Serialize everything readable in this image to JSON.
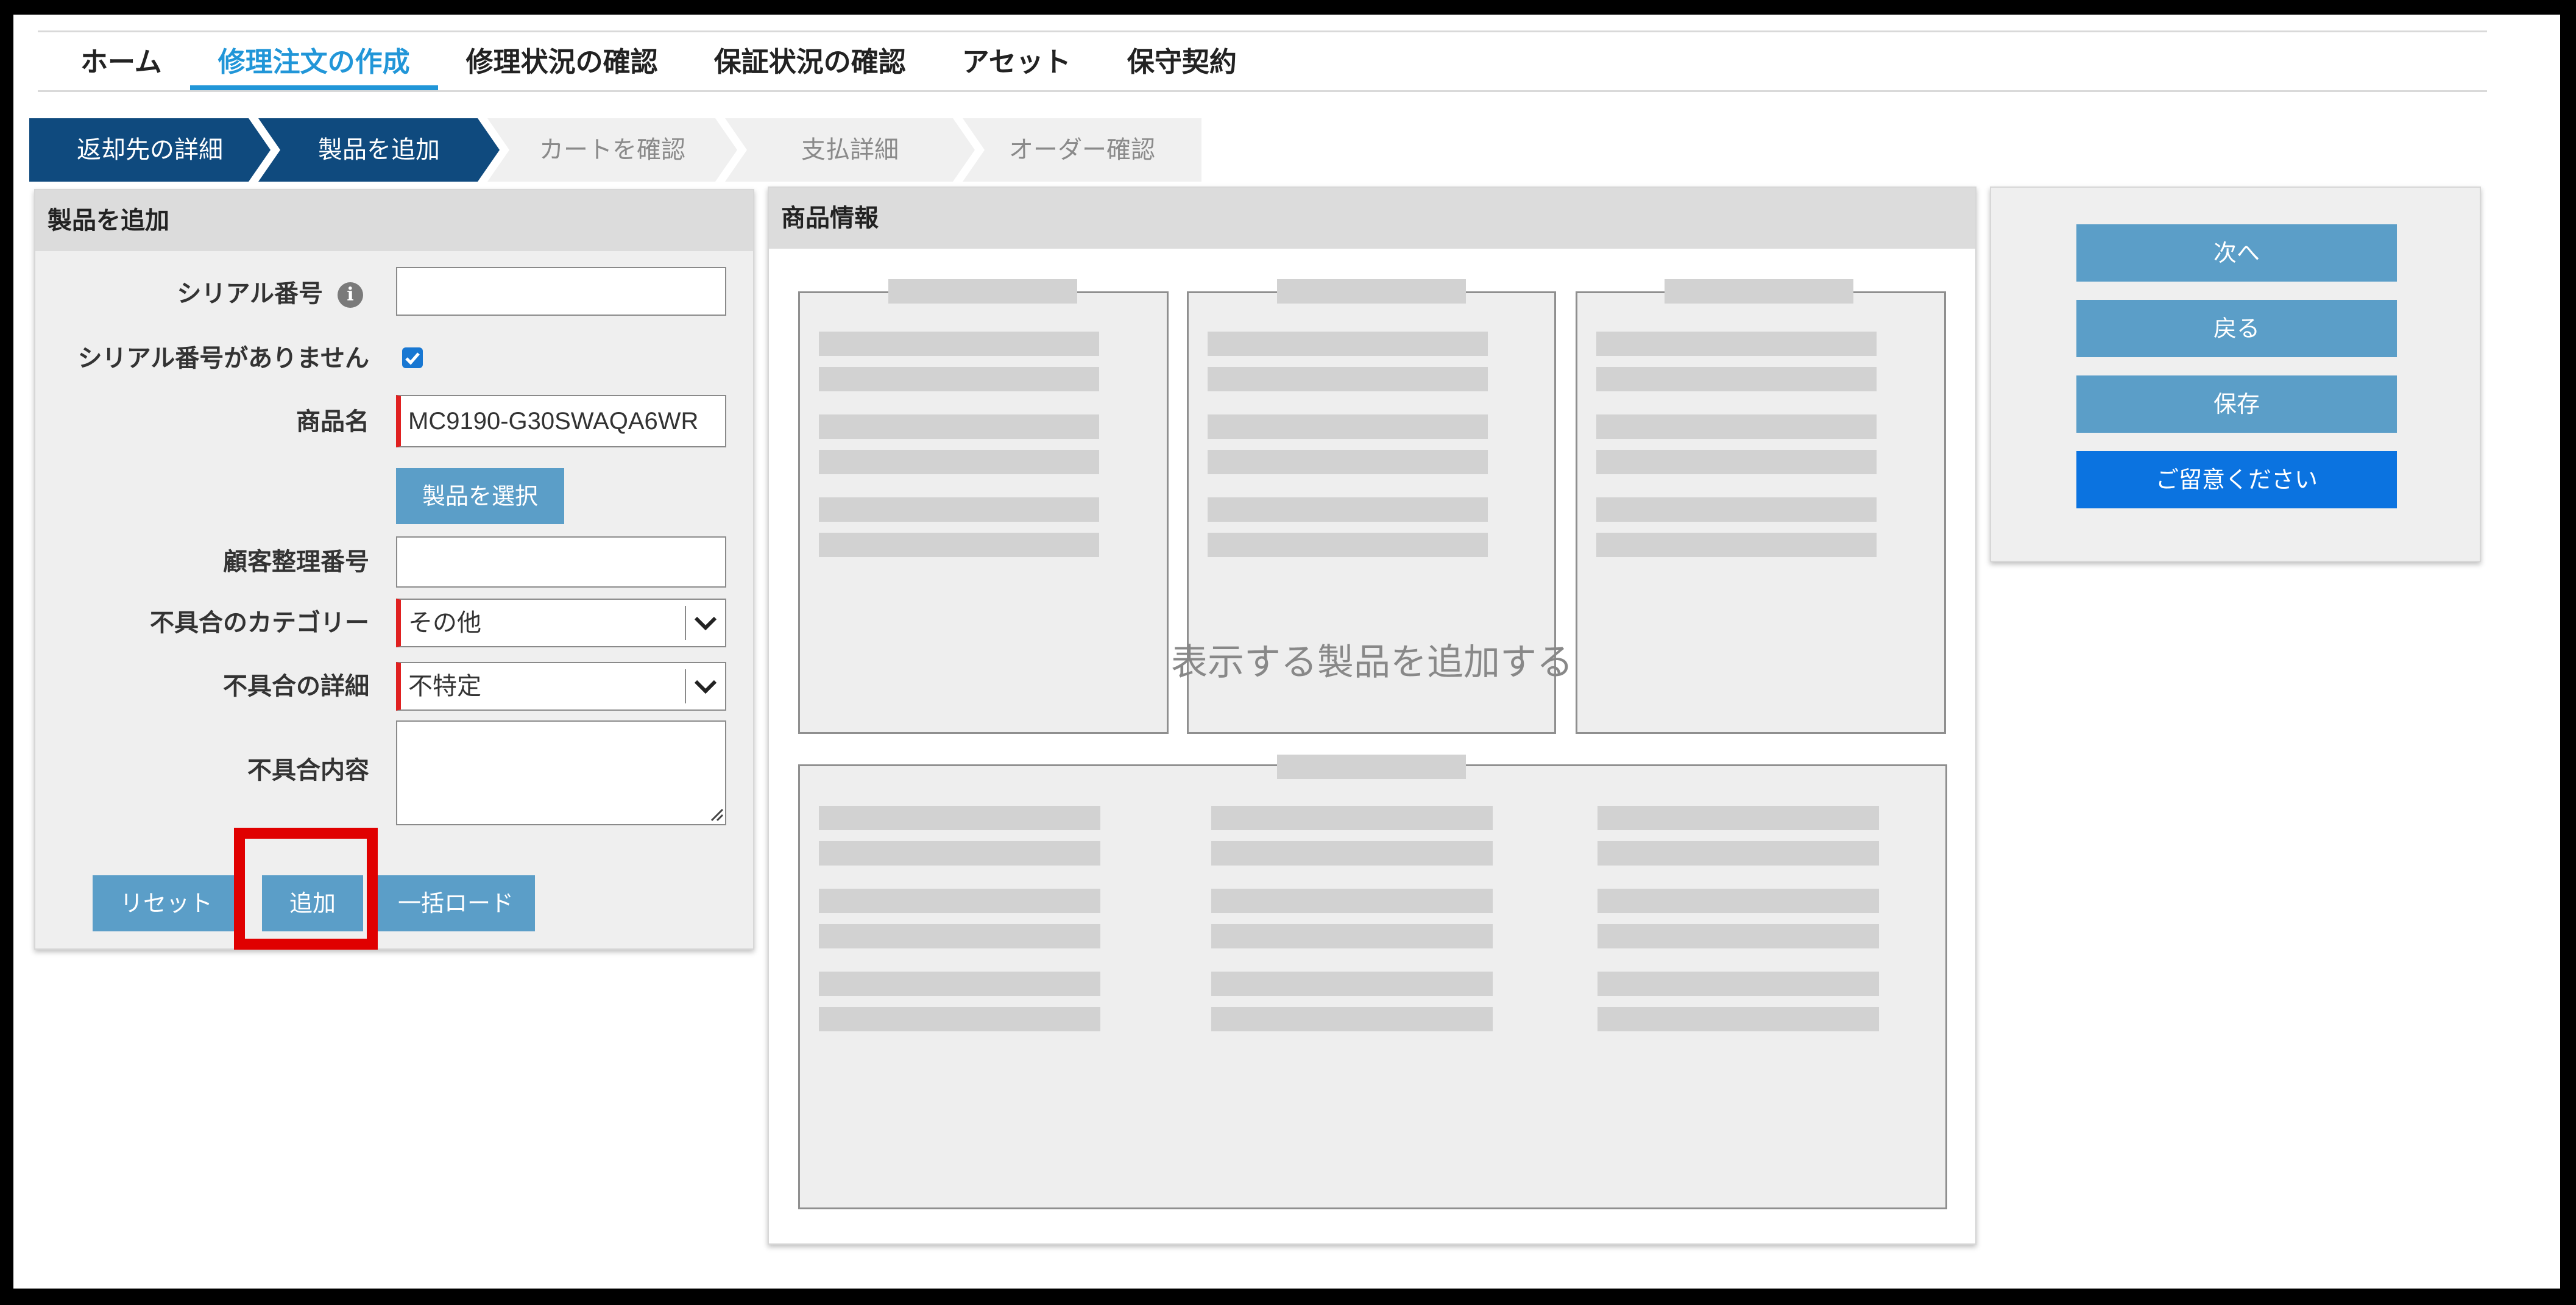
{
  "nav": {
    "tabs": [
      {
        "label": "ホーム"
      },
      {
        "label": "修理注文の作成"
      },
      {
        "label": "修理状況の確認"
      },
      {
        "label": "保証状況の確認"
      },
      {
        "label": "アセット"
      },
      {
        "label": "保守契約"
      }
    ],
    "active_index": 1
  },
  "stepper": {
    "steps": [
      {
        "label": "返却先の詳細",
        "state": "done"
      },
      {
        "label": "製品を追加",
        "state": "current"
      },
      {
        "label": "カートを確認",
        "state": "todo"
      },
      {
        "label": "支払詳細",
        "state": "todo"
      },
      {
        "label": "オーダー確認",
        "state": "todo"
      }
    ]
  },
  "add_product": {
    "title": "製品を追加",
    "serial_label": "シリアル番号",
    "serial_value": "",
    "no_serial_label": "シリアル番号がありません",
    "no_serial_checked": true,
    "product_name_label": "商品名",
    "product_name_value": "MC9190-G30SWAQA6WR",
    "select_product_label": "製品を選択",
    "customer_ref_label": "顧客整理番号",
    "customer_ref_value": "",
    "fault_category_label": "不具合のカテゴリー",
    "fault_category_value": "その他",
    "fault_detail_label": "不具合の詳細",
    "fault_detail_value": "不特定",
    "fault_content_label": "不具合内容",
    "fault_content_value": "",
    "reset_label": "リセット",
    "add_label": "追加",
    "bulk_load_label": "一括ロード"
  },
  "product_info": {
    "title": "商品情報",
    "empty_message": "表示する製品を追加する"
  },
  "actions": {
    "next_label": "次へ",
    "back_label": "戻る",
    "save_label": "保存",
    "notice_label": "ご留意ください"
  },
  "colors": {
    "accent": "#2196d8",
    "step_done": "#0f4a7e",
    "button": "#5b9ec8",
    "notice_button": "#0b73e0",
    "highlight": "#e00000",
    "required": "#e02020"
  }
}
